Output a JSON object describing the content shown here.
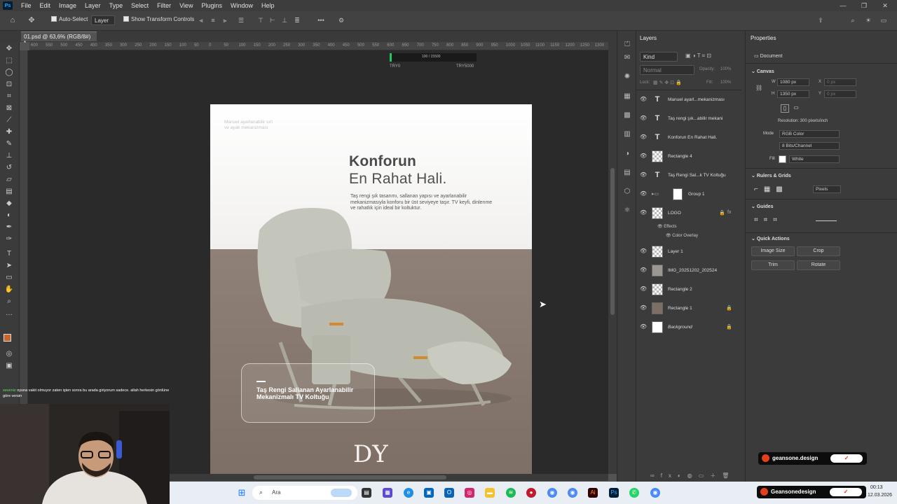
{
  "app": {
    "logo": "Ps",
    "menu": [
      "File",
      "Edit",
      "Image",
      "Layer",
      "Type",
      "Select",
      "Filter",
      "View",
      "Plugins",
      "Window",
      "Help"
    ],
    "window_controls": [
      "—",
      "❐",
      "✕"
    ]
  },
  "options_bar": {
    "auto_select_label": "Auto-Select",
    "auto_select_target": "Layer",
    "show_transform_label": "Show Transform Controls"
  },
  "document_tab": {
    "label": "01.psd @ 63,6% (RGB/8#) *"
  },
  "ruler_marks": [
    "600",
    "550",
    "500",
    "450",
    "400",
    "350",
    "300",
    "250",
    "200",
    "150",
    "100",
    "50",
    "0",
    "50",
    "100",
    "150",
    "200",
    "250",
    "300",
    "350",
    "400",
    "450",
    "500",
    "550",
    "600",
    "650",
    "700",
    "750",
    "800",
    "850",
    "900",
    "950",
    "1000",
    "1050",
    "1100",
    "1150",
    "1200",
    "1250",
    "1300"
  ],
  "overlay_bar": {
    "left_label": "TRY0",
    "right_label": "TRY5000",
    "mid_label": "100 / 15500"
  },
  "artboard": {
    "side_note": "Manuel ayarlanabilir sırt ve ayak mekanizması",
    "headline_bold": "Konforun",
    "headline_regular": "En Rahat Hali.",
    "description": "Taş rengi şık tasarımı, sallanan yapısı ve ayarlanabilir mekanizmasıyla konforu bir üst seviyeye taşır. TV keyfi, dinlenme ve rahatlık için ideal bir koltuktur.",
    "card_text": "Taş Rengi Sallanan Ayarlanabilir Mekanizmalı TV Koltuğu",
    "logo_text": "DY"
  },
  "layers_panel": {
    "title": "Layers",
    "filter_kind": "Kind",
    "blend_mode": "Normal",
    "opacity_label": "Opacity:",
    "opacity_value": "100%",
    "lock_label": "Lock:",
    "fill_label": "Fill:",
    "fill_value": "100%",
    "layers": [
      {
        "name": "Manuel ayarl...mekanizması",
        "kind": "text"
      },
      {
        "name": "Taş rengi şık...abilir mekani",
        "kind": "text"
      },
      {
        "name": "Konforun En Rahat Hali.",
        "kind": "text"
      },
      {
        "name": "Rectangle 4",
        "kind": "shape"
      },
      {
        "name": "Taş Rengi Sal...k TV Koltuğu",
        "kind": "text"
      },
      {
        "name": "Group 1",
        "kind": "group"
      },
      {
        "name": "LOGO",
        "kind": "smart"
      },
      {
        "name": "Layer 1",
        "kind": "pixel"
      },
      {
        "name": "IMG_20251202_202524",
        "kind": "smart"
      },
      {
        "name": "Rectangle 2",
        "kind": "shape"
      },
      {
        "name": "Rectangle 1",
        "kind": "shape"
      },
      {
        "name": "Background",
        "kind": "background"
      }
    ],
    "effects_label": "Effects",
    "color_overlay_label": "Color Overlay"
  },
  "properties_panel": {
    "title": "Properties",
    "doc_label": "Document",
    "canvas_section": "Canvas",
    "w_label": "W",
    "w_value": "1080 px",
    "h_label": "H",
    "h_value": "1350 px",
    "x_label": "X",
    "x_value": "0 px",
    "y_label": "Y",
    "y_value": "0 px",
    "resolution": "Resolution: 300 pixels/inch",
    "mode_label": "Mode",
    "mode_value": "RGB Color",
    "bits_value": "8 Bits/Channel",
    "fill_label": "Fill",
    "fill_value": "White",
    "rulers_section": "Rulers & Grids",
    "units_value": "Pixels",
    "guides_section": "Guides",
    "quick_actions_section": "Quick Actions",
    "btn_image_size": "Image Size",
    "btn_crop": "Crop",
    "btn_trim": "Trim",
    "btn_rotate": "Rotate"
  },
  "badges": {
    "small": "geansone.design",
    "large": "Geansonedesign",
    "follow_mark": "✓"
  },
  "taskbar": {
    "search_placeholder": "Ara",
    "time": "00:13",
    "date": "12.03.2026"
  },
  "chat": {
    "user": "seveniz",
    "message": "oyuna vakit olmuyor zaten işten sonra bu arada giriyorum sadece. allah herkesin gönlüne göre versin"
  },
  "colors": {
    "accent_ps": "#31a8ff",
    "fg_swatch": "#c7652c",
    "bg_swatch": "#000000"
  }
}
